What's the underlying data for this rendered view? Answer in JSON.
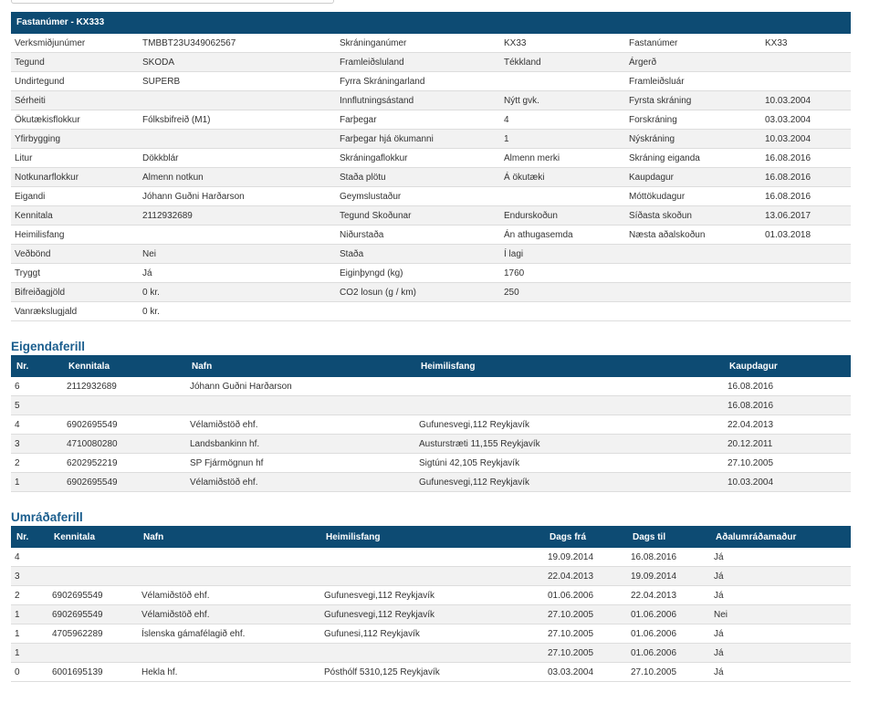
{
  "header": {
    "title": "Fastanúmer - KX333"
  },
  "vehicle": {
    "rows": [
      [
        "Verksmiðjunúmer",
        "TMBBT23U349062567",
        "Skráninganúmer",
        "KX33",
        "Fastanúmer",
        "KX33"
      ],
      [
        "Tegund",
        "SKODA",
        "Framleiðsluland",
        "Tékkland",
        "Árgerð",
        ""
      ],
      [
        "Undirtegund",
        "SUPERB",
        "Fyrra Skráningarland",
        "",
        "Framleiðsluár",
        ""
      ],
      [
        "Sérheiti",
        "",
        "Innflutningsástand",
        "Nýtt gvk.",
        "Fyrsta skráning",
        "10.03.2004"
      ],
      [
        "Ökutækisflokkur",
        "Fólksbifreið (M1)",
        "Farþegar",
        "4",
        "Forskráning",
        "03.03.2004"
      ],
      [
        "Yfirbygging",
        "",
        "Farþegar hjá ökumanni",
        "1",
        "Nýskráning",
        "10.03.2004"
      ],
      [
        "Litur",
        "Dökkblár",
        "Skráningaflokkur",
        "Almenn merki",
        "Skráning eiganda",
        "16.08.2016"
      ],
      [
        "Notkunarflokkur",
        "Almenn notkun",
        "Staða plötu",
        "Á ökutæki",
        "Kaupdagur",
        "16.08.2016"
      ],
      [
        "Eigandi",
        "Jóhann Guðni Harðarson",
        "Geymslustaður",
        "",
        "Móttökudagur",
        "16.08.2016"
      ],
      [
        "Kennitala",
        "2112932689",
        "Tegund Skoðunar",
        "Endurskoðun",
        "Síðasta skoðun",
        "13.06.2017"
      ],
      [
        "Heimilisfang",
        "",
        "Niðurstaða",
        "Án athugasemda",
        "Næsta aðalskoðun",
        "01.03.2018"
      ],
      [
        "Veðbönd",
        "Nei",
        "Staða",
        "Í lagi",
        "",
        ""
      ],
      [
        "Tryggt",
        "Já",
        "Eiginþyngd (kg)",
        "1760",
        "",
        ""
      ],
      [
        "Bifreiðagjöld",
        "0 kr.",
        "CO2 losun (g / km)",
        "250",
        "",
        ""
      ],
      [
        "Vanrækslugjald",
        "0 kr.",
        "",
        "",
        "",
        ""
      ]
    ]
  },
  "owners": {
    "title": "Eigendaferill",
    "columns": [
      "Nr.",
      "Kennitala",
      "Nafn",
      "Heimilisfang",
      "Kaupdagur"
    ],
    "rows": [
      [
        "6",
        "2112932689",
        "Jóhann Guðni Harðarson",
        "",
        "16.08.2016"
      ],
      [
        "5",
        "",
        "",
        "",
        "16.08.2016"
      ],
      [
        "4",
        "6902695549",
        "Vélamiðstöð ehf.",
        "Gufunesvegi,112 Reykjavík",
        "22.04.2013"
      ],
      [
        "3",
        "4710080280",
        "Landsbankinn hf.",
        "Austurstræti 11,155 Reykjavík",
        "20.12.2011"
      ],
      [
        "2",
        "6202952219",
        "SP Fjármögnun hf",
        "Sigtúni 42,105 Reykjavík",
        "27.10.2005"
      ],
      [
        "1",
        "6902695549",
        "Vélamiðstöð ehf.",
        "Gufunesvegi,112 Reykjavík",
        "10.03.2004"
      ]
    ]
  },
  "operators": {
    "title": "Umráðaferill",
    "columns": [
      "Nr.",
      "Kennitala",
      "Nafn",
      "Heimilisfang",
      "Dags frá",
      "Dags til",
      "Aðalumráðamaður"
    ],
    "rows": [
      [
        "4",
        "",
        "",
        "",
        "19.09.2014",
        "16.08.2016",
        "Já"
      ],
      [
        "3",
        "",
        "",
        "",
        "22.04.2013",
        "19.09.2014",
        "Já"
      ],
      [
        "2",
        "6902695549",
        "Vélamiðstöð ehf.",
        "Gufunesvegi,112 Reykjavík",
        "01.06.2006",
        "22.04.2013",
        "Já"
      ],
      [
        "1",
        "6902695549",
        "Vélamiðstöð ehf.",
        "Gufunesvegi,112 Reykjavík",
        "27.10.2005",
        "01.06.2006",
        "Nei"
      ],
      [
        "1",
        "4705962289",
        "Íslenska gámafélagið ehf.",
        "Gufunesi,112 Reykjavík",
        "27.10.2005",
        "01.06.2006",
        "Já"
      ],
      [
        "1",
        "",
        "",
        "",
        "27.10.2005",
        "01.06.2006",
        "Já"
      ],
      [
        "0",
        "6001695139",
        "Hekla hf.",
        "Pósthólf 5310,125 Reykjavík",
        "03.03.2004",
        "27.10.2005",
        "Já"
      ]
    ]
  }
}
